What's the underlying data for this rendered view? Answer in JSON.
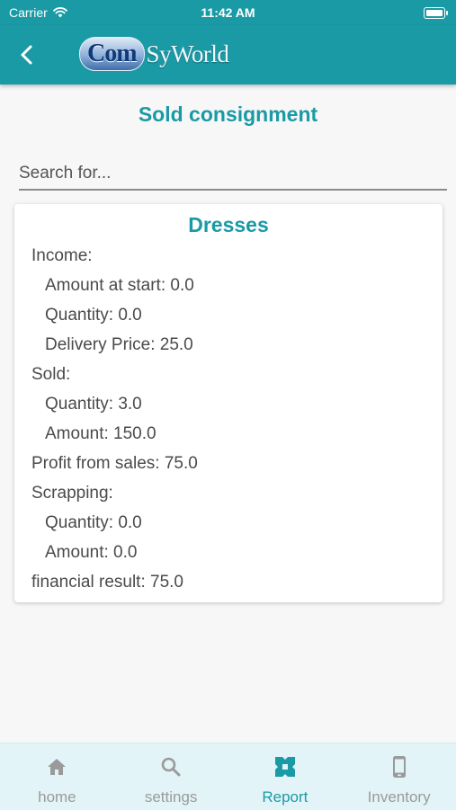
{
  "status_bar": {
    "carrier": "Carrier",
    "time": "11:42 AM"
  },
  "app_bar": {
    "logo_part1": "Com",
    "logo_part2": "SyWorld"
  },
  "page": {
    "title": "Sold consignment"
  },
  "search": {
    "placeholder": "Search for..."
  },
  "card": {
    "title": "Dresses",
    "income_label": "Income:",
    "amount_at_start": "Amount at start: 0.0",
    "income_quantity": "Quantity: 0.0",
    "delivery_price": "Delivery Price: 25.0",
    "sold_label": "Sold:",
    "sold_quantity": "Quantity: 3.0",
    "sold_amount": "Amount: 150.0",
    "profit": "Profit from sales: 75.0",
    "scrapping_label": "Scrapping:",
    "scrapping_quantity": "Quantity: 0.0",
    "scrapping_amount": "Amount: 0.0",
    "financial_result": "financial result: 75.0"
  },
  "bottom_nav": {
    "items": [
      {
        "label": "home",
        "icon": "home-icon",
        "active": false
      },
      {
        "label": "settings",
        "icon": "search-icon",
        "active": false
      },
      {
        "label": "Report",
        "icon": "report-icon",
        "active": true
      },
      {
        "label": "Inventory",
        "icon": "phone-icon",
        "active": false
      }
    ]
  },
  "colors": {
    "primary": "#1a9aa5",
    "background": "#f7f7f7",
    "nav_background": "#e3f4f8",
    "inactive": "#9a9a9a"
  }
}
